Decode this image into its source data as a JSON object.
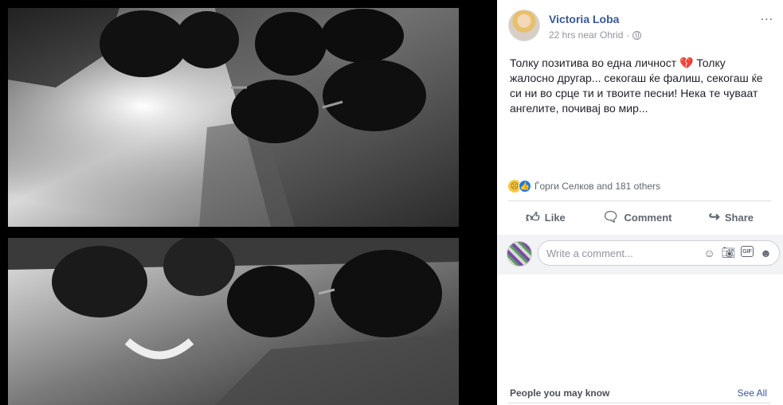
{
  "post": {
    "author": "Victoria Loba",
    "time": "22 hrs near Ohrid",
    "separator": "·",
    "text": "Толку позитива во една личност 💔 Толку жалосно другар... секогаш ќе фалиш, секогаш ќе си ни во срце ти и твоите песни! Нека те чуваат ангелите, почивај во мир...",
    "more_icon": "..."
  },
  "reactions": {
    "summary": "Ѓорги Селков and 181 others",
    "icons": [
      "sad-icon",
      "like-icon"
    ]
  },
  "actions": {
    "like": "Like",
    "comment": "Comment",
    "share": "Share"
  },
  "comment_input": {
    "placeholder": "Write a comment..."
  },
  "sidebar_footer": {
    "people_title": "People you may know",
    "see_all": "See All"
  },
  "colors": {
    "link": "#385898",
    "text": "#1d2129",
    "meta": "#90949c"
  }
}
